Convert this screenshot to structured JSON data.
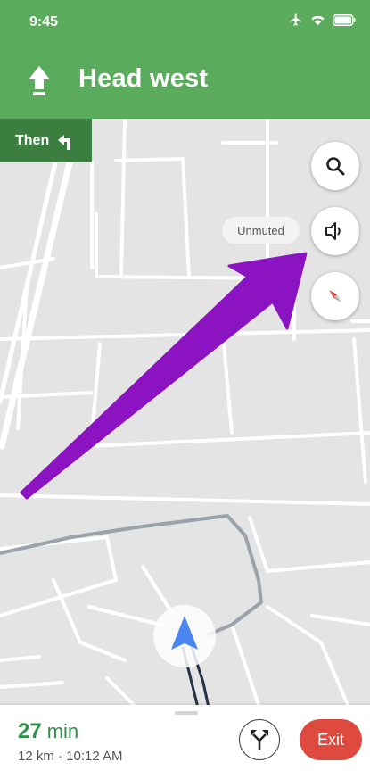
{
  "status_bar": {
    "time": "9:45"
  },
  "navigation": {
    "instruction": "Head west",
    "next_step_label": "Then"
  },
  "map_controls": {
    "mute_status_label": "Unmuted"
  },
  "trip": {
    "eta_value": "27",
    "eta_unit": "min",
    "details": "12 km · 10:12 AM",
    "exit_label": "Exit"
  },
  "colors": {
    "header": "#5aac5c",
    "then_box": "#3c7d40",
    "eta_text": "#2e8f4a",
    "exit_button": "#de4a3e",
    "annotation_arrow": "#8b13c2",
    "location_marker": "#4a86f0"
  },
  "icons": {
    "status": [
      "airplane-icon",
      "wifi-icon",
      "battery-icon"
    ],
    "turn": "arrow-up-icon",
    "then": "turn-left-icon",
    "controls": [
      "search-icon",
      "speaker-icon",
      "compass-icon"
    ],
    "routes": "alternate-routes-icon"
  }
}
